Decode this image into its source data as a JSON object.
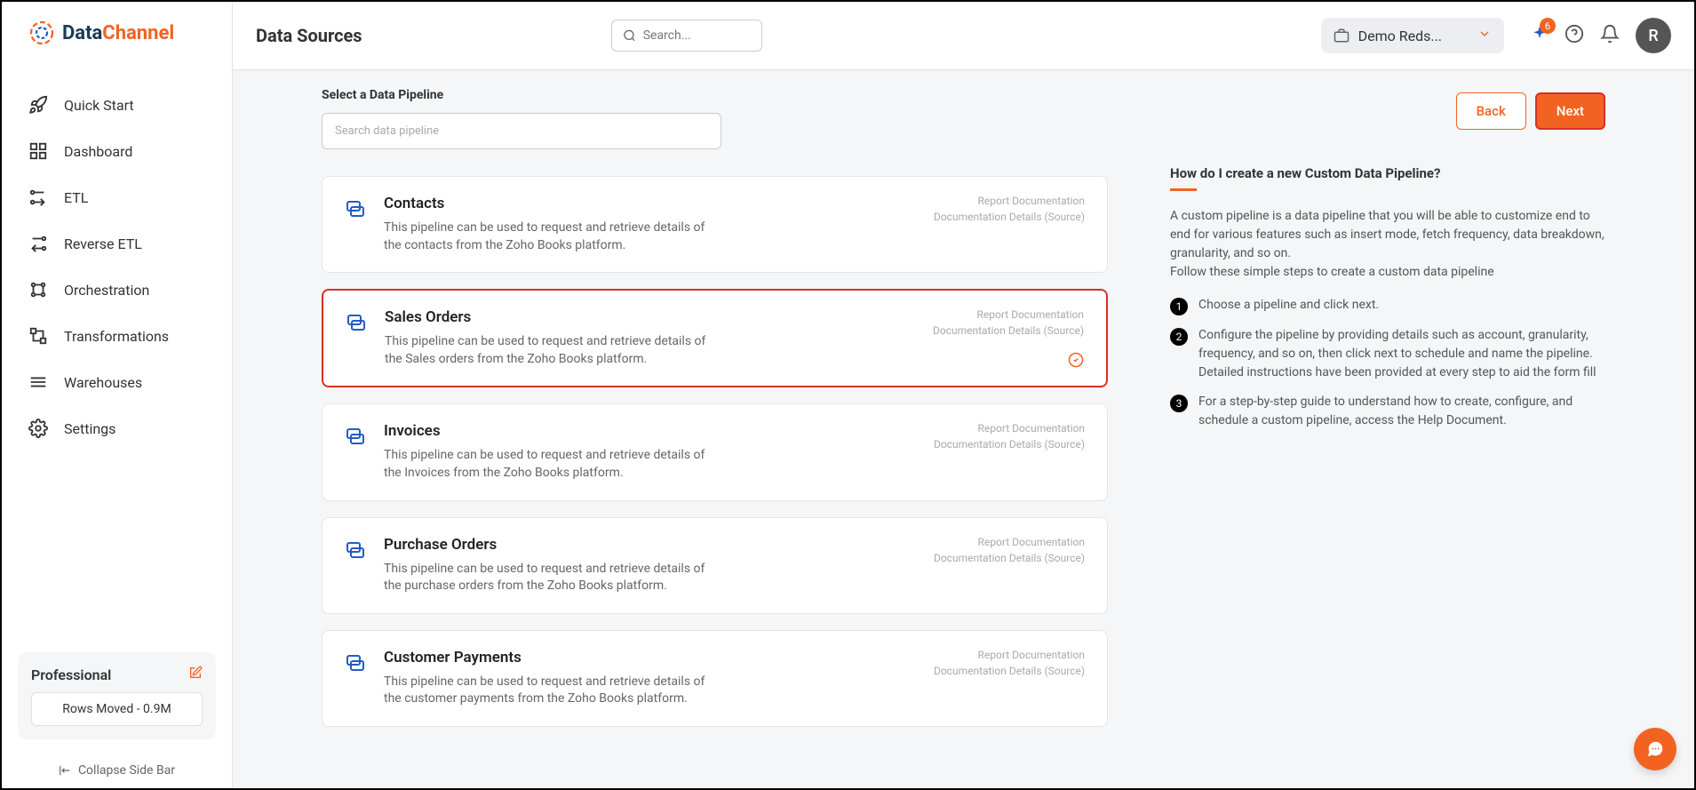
{
  "logo": {
    "brand1": "Data",
    "brand2": "Channel"
  },
  "sidebar": {
    "items": [
      {
        "label": "Quick Start"
      },
      {
        "label": "Dashboard"
      },
      {
        "label": "ETL"
      },
      {
        "label": "Reverse ETL"
      },
      {
        "label": "Orchestration"
      },
      {
        "label": "Transformations"
      },
      {
        "label": "Warehouses"
      },
      {
        "label": "Settings"
      }
    ],
    "plan": {
      "title": "Professional",
      "rows": "Rows Moved - 0.9M"
    },
    "collapse": "Collapse Side Bar"
  },
  "topbar": {
    "title": "Data Sources",
    "search_placeholder": "Search...",
    "workspace": "Demo Reds...",
    "badge": "6",
    "avatar": "R"
  },
  "main": {
    "section_title": "Select a Data Pipeline",
    "search_placeholder": "Search data pipeline",
    "pipelines": [
      {
        "title": "Contacts",
        "desc": "This pipeline can be used to request and retrieve details of the contacts from the Zoho Books platform.",
        "link1": "Report Documentation",
        "link2": "Documentation Details (Source)",
        "selected": false
      },
      {
        "title": "Sales Orders",
        "desc": "This pipeline can be used to request and retrieve details of the Sales orders from the Zoho Books platform.",
        "link1": "Report Documentation",
        "link2": "Documentation Details (Source)",
        "selected": true
      },
      {
        "title": "Invoices",
        "desc": "This pipeline can be used to request and retrieve details of the Invoices from the Zoho Books platform.",
        "link1": "Report Documentation",
        "link2": "Documentation Details (Source)",
        "selected": false
      },
      {
        "title": "Purchase Orders",
        "desc": "This pipeline can be used to request and retrieve details of the purchase orders from the Zoho Books platform.",
        "link1": "Report Documentation",
        "link2": "Documentation Details (Source)",
        "selected": false
      },
      {
        "title": "Customer Payments",
        "desc": "This pipeline can be used to request and retrieve details of the customer payments from the Zoho Books platform.",
        "link1": "Report Documentation",
        "link2": "Documentation Details (Source)",
        "selected": false
      }
    ]
  },
  "actions": {
    "back": "Back",
    "next": "Next"
  },
  "help": {
    "title": "How do I create a new Custom Data Pipeline?",
    "para1": "A custom pipeline is a data pipeline that you will be able to customize end to end for various features such as insert mode, fetch frequency, data breakdown, granularity, and so on.",
    "para2": "Follow these simple steps to create a custom data pipeline",
    "steps": [
      "Choose a pipeline and click next.",
      "Configure the pipeline by providing details such as account, granularity, frequency, and so on, then click next to schedule and name the pipeline. Detailed instructions have been provided at every step to aid the form fill",
      "For a step-by-step guide to understand how to create, configure, and schedule a custom pipeline, access the Help Document."
    ]
  }
}
